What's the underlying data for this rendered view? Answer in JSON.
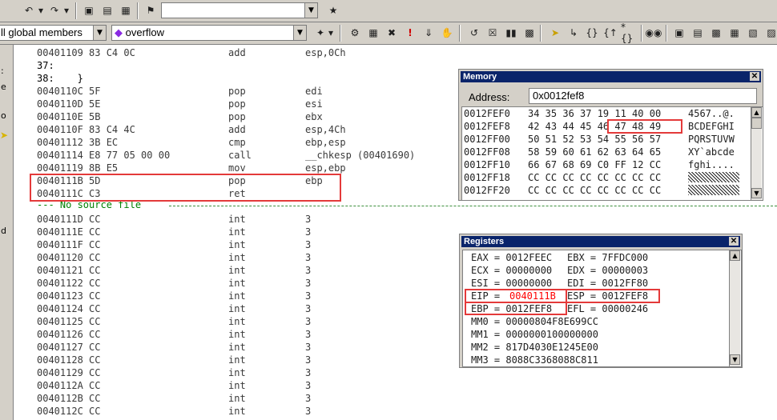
{
  "toolbar1": {
    "combo_value": "",
    "icons": [
      "undo-icon",
      "redo-icon",
      "window-icon",
      "output-icon",
      "workspace-icon",
      "wizard-icon",
      "find-in-files-icon"
    ]
  },
  "toolbar2": {
    "class_combo": "ll global members",
    "member_combo": "overflow",
    "member_symbol": "◆"
  },
  "left_strip_chars": [
    ":",
    "e",
    "o",
    "d"
  ],
  "code": {
    "lines": [
      {
        "addr": "00401109 83 C4 0C",
        "mn": "add",
        "op": "esp,0Ch"
      },
      {
        "addr": "37:",
        "mn": "",
        "op": ""
      },
      {
        "addr": "38:    }",
        "mn": "",
        "op": ""
      },
      {
        "addr": "0040110C 5F",
        "mn": "pop",
        "op": "edi"
      },
      {
        "addr": "0040110D 5E",
        "mn": "pop",
        "op": "esi"
      },
      {
        "addr": "0040110E 5B",
        "mn": "pop",
        "op": "ebx"
      },
      {
        "addr": "0040110F 83 C4 4C",
        "mn": "add",
        "op": "esp,4Ch"
      },
      {
        "addr": "00401112 3B EC",
        "mn": "cmp",
        "op": "ebp,esp"
      },
      {
        "addr": "00401114 E8 77 05 00 00",
        "mn": "call",
        "op": "__chkesp (00401690)"
      },
      {
        "addr": "00401119 8B E5",
        "mn": "mov",
        "op": "esp,ebp"
      },
      {
        "addr": "0040111B 5D",
        "mn": "pop",
        "op": "ebp"
      },
      {
        "addr": "0040111C C3",
        "mn": "ret",
        "op": ""
      }
    ],
    "no_source": "--- No source file",
    "int_lines": [
      {
        "addr": "0040111D CC",
        "mn": "int",
        "op": "3"
      },
      {
        "addr": "0040111E CC",
        "mn": "int",
        "op": "3"
      },
      {
        "addr": "0040111F CC",
        "mn": "int",
        "op": "3"
      },
      {
        "addr": "00401120 CC",
        "mn": "int",
        "op": "3"
      },
      {
        "addr": "00401121 CC",
        "mn": "int",
        "op": "3"
      },
      {
        "addr": "00401122 CC",
        "mn": "int",
        "op": "3"
      },
      {
        "addr": "00401123 CC",
        "mn": "int",
        "op": "3"
      },
      {
        "addr": "00401124 CC",
        "mn": "int",
        "op": "3"
      },
      {
        "addr": "00401125 CC",
        "mn": "int",
        "op": "3"
      },
      {
        "addr": "00401126 CC",
        "mn": "int",
        "op": "3"
      },
      {
        "addr": "00401127 CC",
        "mn": "int",
        "op": "3"
      },
      {
        "addr": "00401128 CC",
        "mn": "int",
        "op": "3"
      },
      {
        "addr": "00401129 CC",
        "mn": "int",
        "op": "3"
      },
      {
        "addr": "0040112A CC",
        "mn": "int",
        "op": "3"
      },
      {
        "addr": "0040112B CC",
        "mn": "int",
        "op": "3"
      },
      {
        "addr": "0040112C CC",
        "mn": "int",
        "op": "3"
      }
    ]
  },
  "memory": {
    "title": "Memory",
    "address_label": "Address:",
    "address_value": "0x0012fef8",
    "rows": [
      {
        "addr": "0012FEF0",
        "bytes": "34 35 36 37 19 11 40 00",
        "ascii": "4567..@."
      },
      {
        "addr": "0012FEF8",
        "bytes": "42 43 44 45 46 47 48 49",
        "ascii": "BCDEFGHI"
      },
      {
        "addr": "0012FF00",
        "bytes": "50 51 52 53 54 55 56 57",
        "ascii": "PQRSTUVW"
      },
      {
        "addr": "0012FF08",
        "bytes": "58 59 60 61 62 63 64 65",
        "ascii": "XY`abcde"
      },
      {
        "addr": "0012FF10",
        "bytes": "66 67 68 69 C0 FF 12 CC",
        "ascii": "fghi...."
      },
      {
        "addr": "0012FF18",
        "bytes": "CC CC CC CC CC CC CC CC",
        "ascii": ""
      },
      {
        "addr": "0012FF20",
        "bytes": "CC CC CC CC CC CC CC CC",
        "ascii": ""
      }
    ]
  },
  "registers": {
    "title": "Registers",
    "rows": [
      {
        "left": "EAX = 0012FEEC",
        "right": "EBX = 7FFDC000"
      },
      {
        "left": "ECX = 00000000",
        "right": "EDX = 00000003"
      },
      {
        "left": "ESI = 00000000",
        "right": "EDI = 0012FF80"
      },
      {
        "left": "EIP = ",
        "eip_value": "0040111B",
        "right": "ESP = 0012FEF8"
      },
      {
        "left": "EBP = 0012FEF8",
        "right": "EFL = 00000246"
      },
      {
        "left": "MM0 = 00000804F8E699CC",
        "right": ""
      },
      {
        "left": "MM1 = 0000000100000000",
        "right": ""
      },
      {
        "left": "MM2 = 817D4030E1245E00",
        "right": ""
      },
      {
        "left": "MM3 = 8088C3368088C811",
        "right": ""
      }
    ],
    "changed_color": "#ff0000"
  },
  "colors": {
    "highlight_box": "#e43a3a",
    "title_bar": "#0a246a",
    "source_marker": "#008000"
  }
}
